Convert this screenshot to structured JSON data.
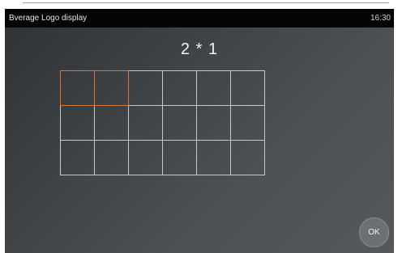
{
  "status_bar": {
    "title": "Bverage Logo display",
    "time": "16:30"
  },
  "selection_size": "2 * 1",
  "grid": {
    "rows": 3,
    "columns": 6,
    "selected_cells": [
      [
        0,
        0
      ],
      [
        0,
        1
      ]
    ],
    "selection_color": "#d9762a"
  },
  "ok_button": {
    "label": "OK"
  }
}
